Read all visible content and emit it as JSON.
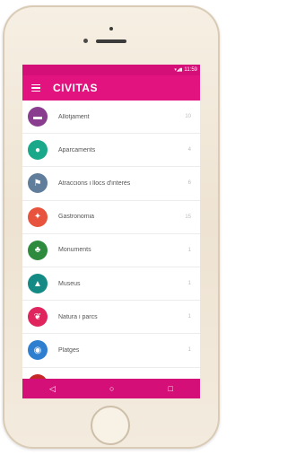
{
  "status_bar": {
    "icons": "▾◢▮",
    "time": "11:59"
  },
  "app_bar": {
    "title": "CIVITAS"
  },
  "categories": [
    {
      "label": "Allotjament",
      "count": "10",
      "color": "#8a3d8f",
      "icon": "bed-icon",
      "glyph": "▬"
    },
    {
      "label": "Aparcaments",
      "count": "4",
      "color": "#19a88a",
      "icon": "location-pin-icon",
      "glyph": "●"
    },
    {
      "label": "Atraccions i llocs d'interès",
      "count": "6",
      "color": "#607d9b",
      "icon": "flag-icon",
      "glyph": "⚑"
    },
    {
      "label": "Gastronomia",
      "count": "15",
      "color": "#e8533d",
      "icon": "restaurant-icon",
      "glyph": "✦"
    },
    {
      "label": "Monuments",
      "count": "1",
      "color": "#2e8b3e",
      "icon": "monument-icon",
      "glyph": "♣"
    },
    {
      "label": "Museus",
      "count": "1",
      "color": "#148a85",
      "icon": "museum-icon",
      "glyph": "▲"
    },
    {
      "label": "Natura i parcs",
      "count": "1",
      "color": "#e0245e",
      "icon": "leaf-icon",
      "glyph": "❦"
    },
    {
      "label": "Platges",
      "count": "1",
      "color": "#2f7fd0",
      "icon": "beach-icon",
      "glyph": "◉"
    },
    {
      "label": "",
      "count": "",
      "color": "#c62828",
      "icon": "category-icon",
      "glyph": ""
    }
  ],
  "nav": {
    "back": "◁",
    "home": "○",
    "recents": "□"
  }
}
